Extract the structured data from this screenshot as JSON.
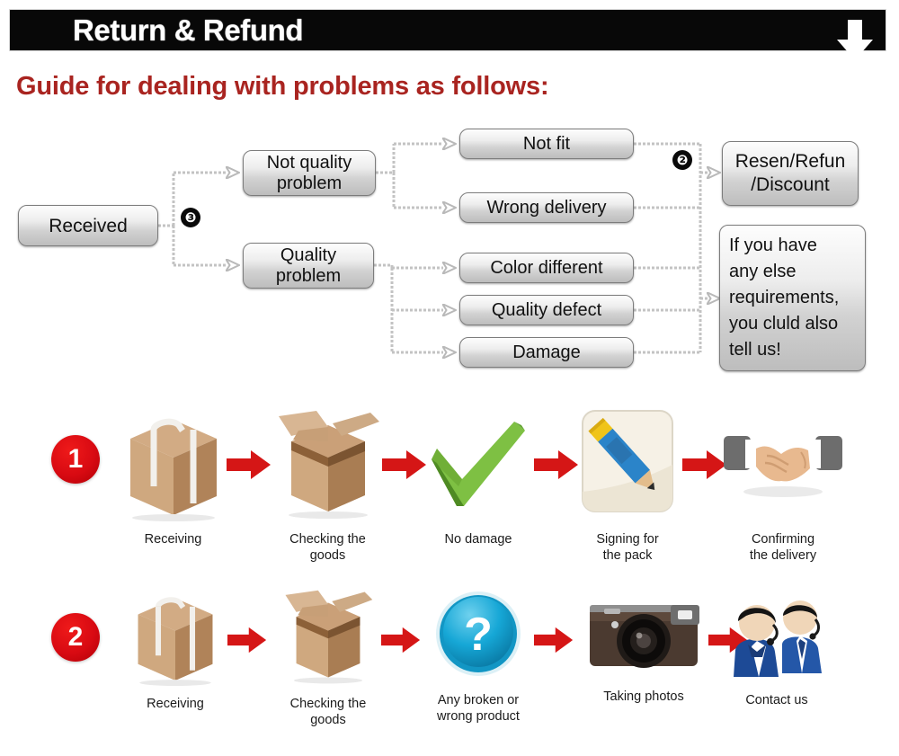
{
  "header": {
    "title": "Return & Refund",
    "arrow_icon": "down-arrow-icon"
  },
  "guide": {
    "heading": "Guide for dealing with problems as follows:"
  },
  "flowchart": {
    "nodes": {
      "received": "Received",
      "not_quality_problem": "Not quality\nproblem",
      "quality_problem": "Quality\nproblem",
      "not_fit": "Not fit",
      "wrong_delivery": "Wrong delivery",
      "color_different": "Color different",
      "quality_defect": "Quality defect",
      "damage": "Damage",
      "resend_refund_discount": "Resen/Refun\n/Discount",
      "if_you_have": "If you have\nany else\nrequirements,\nyou cluld also\ntell us!"
    },
    "badges": {
      "branch_three": "❸",
      "branch_two": "❷"
    }
  },
  "process_rows": [
    {
      "number": "1",
      "steps": [
        {
          "icon": "sealed-package-box-icon",
          "label": "Receiving"
        },
        {
          "icon": "open-cardboard-box-icon",
          "label": "Checking the\ngoods"
        },
        {
          "icon": "green-checkmark-icon",
          "label": "No damage"
        },
        {
          "icon": "pencil-signing-icon",
          "label": "Signing for\nthe pack"
        },
        {
          "icon": "handshake-icon",
          "label": "Confirming\nthe delivery"
        }
      ],
      "arrow_icon": "red-right-arrow-icon"
    },
    {
      "number": "2",
      "steps": [
        {
          "icon": "sealed-package-box-icon",
          "label": "Receiving"
        },
        {
          "icon": "open-cardboard-box-icon",
          "label": "Checking the\ngoods"
        },
        {
          "icon": "blue-question-mark-icon",
          "label": "Any broken or\nwrong product"
        },
        {
          "icon": "camera-icon",
          "label": "Taking photos"
        },
        {
          "icon": "support-agents-icon",
          "label": "Contact us"
        }
      ],
      "arrow_icon": "red-right-arrow-icon"
    }
  ],
  "colors": {
    "header_bar": "#080808",
    "header_text": "#ffffff",
    "guide_heading": "#a92420",
    "step_circle_red": "#d80a12",
    "arrow_red": "#d51616",
    "node_border": "#7c7c7c",
    "connector": "#bdbdbd",
    "background": "#ffffff"
  }
}
